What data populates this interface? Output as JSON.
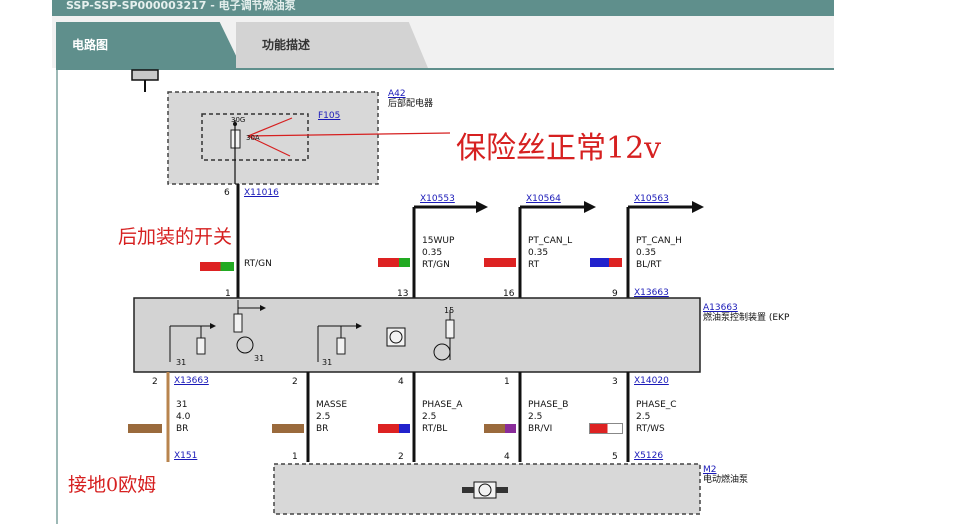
{
  "window": {
    "title": "SSP-SSP-SP000003217 - 电子调节燃油泵"
  },
  "tabs": [
    {
      "label": "电路图"
    },
    {
      "label": "功能描述"
    }
  ],
  "diagram": {
    "components": {
      "a42": {
        "id": "A42",
        "name": "后部配电器"
      },
      "f105": {
        "id": "F105",
        "terminal": "30G",
        "rating": "30A"
      },
      "a13663": {
        "id": "A13663",
        "name": "燃油泵控制装置 (EKP"
      },
      "m2": {
        "id": "M2",
        "name": "电动燃油泵"
      }
    },
    "connectors": {
      "x11016": "X11016",
      "x10553": "X10553",
      "x10564": "X10564",
      "x10563": "X10563",
      "x13663_top": "X13663",
      "x13663_left": "X13663",
      "x14020": "X14020",
      "x151": "X151",
      "x5126": "X5126"
    },
    "wires": {
      "feed": {
        "spec": "RT/GN"
      },
      "wup": {
        "name": "15WUP",
        "gauge": "0.35",
        "color": "RT/GN"
      },
      "pt_can_l": {
        "name": "PT_CAN_L",
        "gauge": "0.35",
        "color": "RT"
      },
      "pt_can_h": {
        "name": "PT_CAN_H",
        "gauge": "0.35",
        "color": "BL/RT"
      },
      "ground": {
        "name": "31",
        "gauge": "4.0",
        "color": "BR"
      },
      "masse": {
        "name": "MASSE",
        "gauge": "2.5",
        "color": "BR"
      },
      "phase_a": {
        "name": "PHASE_A",
        "gauge": "2.5",
        "color": "RT/BL"
      },
      "phase_b": {
        "name": "PHASE_B",
        "gauge": "2.5",
        "color": "BR/VI"
      },
      "phase_c": {
        "name": "PHASE_C",
        "gauge": "2.5",
        "color": "RT/WS"
      }
    },
    "pins": {
      "p6": "6",
      "p1": "1",
      "p13": "13",
      "p16": "16",
      "p9": "9",
      "p2_left": "2",
      "p2": "2",
      "p4": "4",
      "p1_b": "1",
      "p3": "3",
      "m1": "1",
      "m2": "2",
      "m4": "4",
      "m5": "5",
      "internal_15": "15",
      "internal_31a": "31",
      "internal_31b": "31",
      "internal_31c": "31"
    }
  },
  "annotations": {
    "fuse_ok": "保险丝正常12v",
    "aftermarket_switch": "后加装的开关",
    "ground_zero_ohm": "接地0欧姆"
  },
  "colors": {
    "accent": "#5f8f8c",
    "annotation": "#d62020",
    "link": "#1a1ab8"
  }
}
